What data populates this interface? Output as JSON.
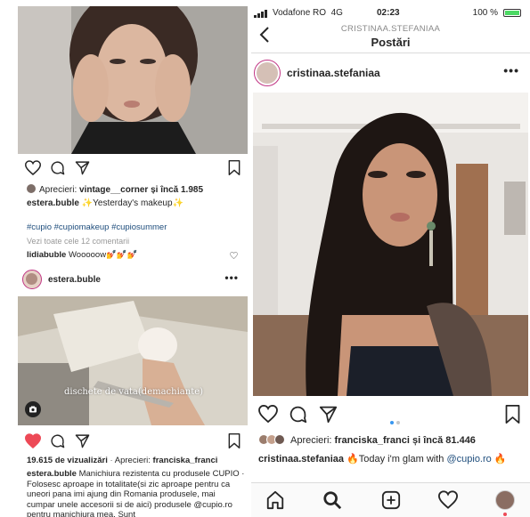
{
  "left": {
    "post1": {
      "liked_by_label": "Aprecieri:",
      "liked_by_user": "vintage__corner",
      "liked_by_rest": "și încă 1.985",
      "caption_user": "estera.buble",
      "caption_text": "✨Yesterday's makeup✨",
      "hashtags": "#cupio #cupiomakeup #cupiosummer",
      "view_all_comments": "Vezi toate cele 12 comentarii",
      "comment_user": "lidiabuble",
      "comment_text": "Wooooow💅💅💅"
    },
    "post2": {
      "username": "estera.buble",
      "image_overlay_text": "dischete de vata(demachiante)",
      "views": "19.615 de vizualizări",
      "liked_by_label": "Aprecieri:",
      "liked_by_user": "franciska_franci",
      "caption_user": "estera.buble",
      "caption_text": "Manichiura rezistenta cu produsele CUPIO · Folosesc aproape in totalitate(si zic aproape pentru ca uneori pana imi ajung din Romania produsele, mai cumpar unele accesorii si de aici) produsele @cupio.ro pentru manichiura mea. Sunt"
    }
  },
  "right": {
    "status_bar": {
      "carrier": "Vodafone RO",
      "network": "4G",
      "time": "02:23",
      "battery": "100 %"
    },
    "nav": {
      "account": "CRISTINAA.STEFANIAA",
      "title": "Postări"
    },
    "post": {
      "username": "cristinaa.stefaniaa",
      "liked_by_label": "Aprecieri:",
      "liked_by_user": "franciska_franci",
      "liked_by_rest": "și încă 81.446",
      "caption_user": "cristinaa.stefaniaa",
      "caption_text": "🔥Today i'm glam with",
      "caption_mention": "@cupio.ro",
      "caption_end": "🔥"
    }
  },
  "colors": {
    "like_red": "#ed4956",
    "link_blue": "#1e4d7c",
    "story_ring": "#c13584",
    "battery_green": "#4cd964",
    "active_dot": "#3897f0"
  },
  "icons": [
    "heart-icon",
    "comment-icon",
    "share-icon",
    "bookmark-icon",
    "more-icon",
    "back-icon",
    "home-icon",
    "search-icon",
    "add-post-icon",
    "activity-icon",
    "camera-icon"
  ]
}
